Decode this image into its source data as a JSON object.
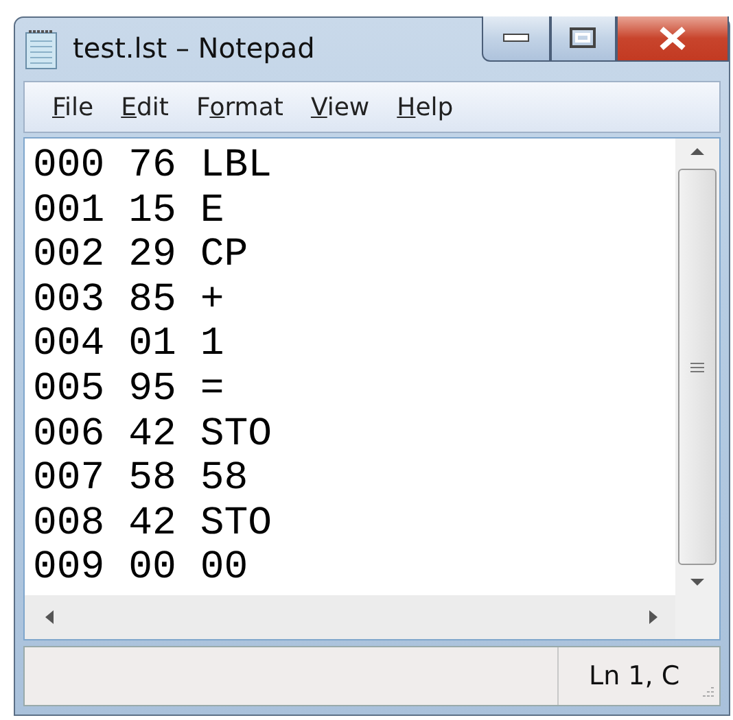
{
  "window": {
    "title": "test.lst – Notepad"
  },
  "menu": [
    {
      "key": "F",
      "after": "ile"
    },
    {
      "key": "E",
      "after": "dit"
    },
    {
      "before": "F",
      "key": "o",
      "after": "rmat"
    },
    {
      "key": "V",
      "after": "iew"
    },
    {
      "key": "H",
      "after": "elp"
    }
  ],
  "editor": {
    "lines": [
      "000 76 LBL",
      "001 15 E",
      "002 29 CP",
      "003 85 +",
      "004 01 1",
      "005 95 =",
      "006 42 STO",
      "007 58 58",
      "008 42 STO",
      "009 00 00"
    ]
  },
  "status_bar": {
    "position": "Ln 1, C"
  }
}
